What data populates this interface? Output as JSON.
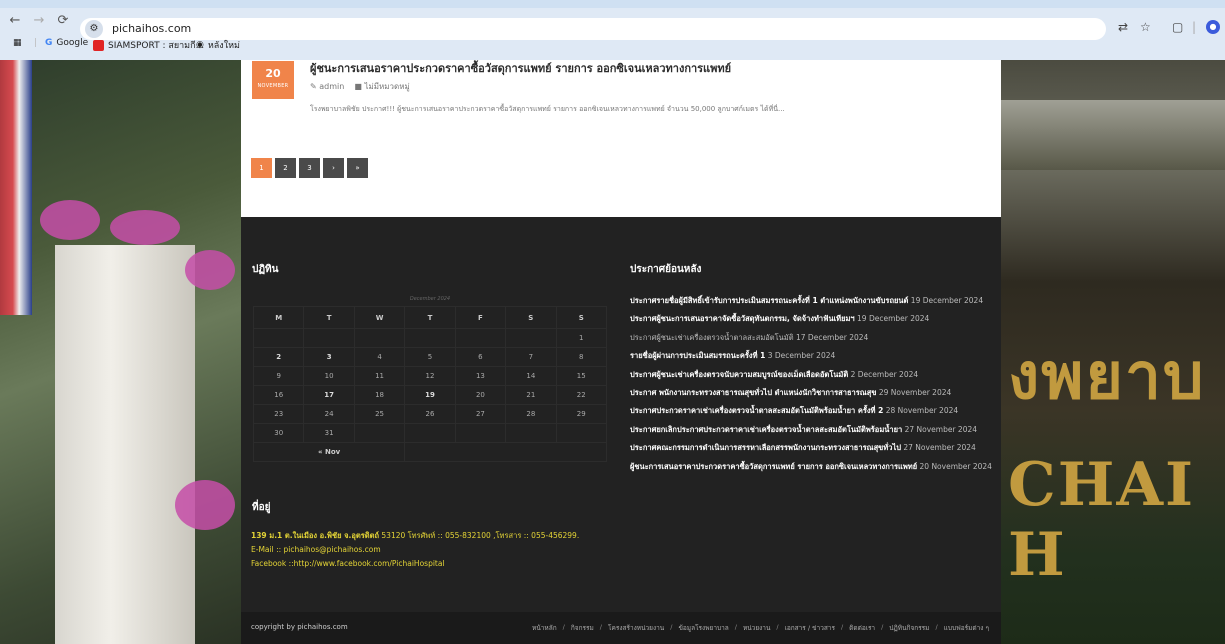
{
  "browser": {
    "url": "pichaihos.com",
    "bookmarks": [
      {
        "label": "Google",
        "icon": "google-icon"
      },
      {
        "label": "SIAMSPORT : สยามกี...",
        "icon": "siamsport-icon"
      },
      {
        "label": "หลังใหม่",
        "icon": "globe-icon"
      }
    ]
  },
  "post": {
    "day": "20",
    "month": "NOVEMBER",
    "title": "ผู้ชนะการเสนอราคาประกวดราคาซื้อวัสดุการแพทย์ รายการ ออกซิเจนเหลวทางการแพทย์",
    "author": "admin",
    "category": "ไม่มีหมวดหมู่",
    "excerpt": "โรงพยาบาลพิชัย ประกาศ!!! ผู้ชนะการเสนอราคาประกวดราคาซื้อวัสดุการแพทย์ รายการ ออกซิเจนเหลวทางการแพทย์ จำนวน 50,000 ลูกบาศก์เมตร ได้ที่นี่..."
  },
  "pagination": [
    "1",
    "2",
    "3",
    "›",
    "»"
  ],
  "calendar": {
    "title": "ปฏิทิน",
    "caption": "December 2024",
    "days": [
      "M",
      "T",
      "W",
      "T",
      "F",
      "S",
      "S"
    ],
    "rows": [
      [
        "",
        "",
        "",
        "",
        "",
        "",
        "1"
      ],
      [
        "2",
        "3",
        "4",
        "5",
        "6",
        "7",
        "8"
      ],
      [
        "9",
        "10",
        "11",
        "12",
        "13",
        "14",
        "15"
      ],
      [
        "16",
        "17",
        "18",
        "19",
        "20",
        "21",
        "22"
      ],
      [
        "23",
        "24",
        "25",
        "26",
        "27",
        "28",
        "29"
      ],
      [
        "30",
        "31",
        "",
        "",
        "",
        "",
        ""
      ]
    ],
    "prev": "« Nov"
  },
  "archive": {
    "title": "ประกาศย้อนหลัง",
    "items": [
      {
        "title": "ประกาศรายชื่อผู้มีสิทธิ์เข้ารับการประเมินสมรรถนะครั้งที่ 1 ตำแหน่งพนักงานขับรถยนต์",
        "date": "19 December 2024"
      },
      {
        "title": "ประกาศผู้ชนะการเสนอราคาจัดซื้อวัสดุทันตกรรม, จัดจ้างทำฟันเทียมฯ",
        "date": "19 December 2024"
      },
      {
        "title": "ประกาศผู้ชนะเช่าเครื่องตรวจน้ำตาลสะสมอัตโนมัติ",
        "date": "17 December 2024"
      },
      {
        "title": "รายชื่อผู้ผ่านการประเมินสมรรถนะครั้งที่ 1",
        "date": "3 December 2024"
      },
      {
        "title": "ประกาศผู้ชนะเช่าเครื่องตรวจนับความสมบูรณ์ของเม็ดเลือดอัตโนมัติ",
        "date": "2 December 2024"
      },
      {
        "title": "ประกาศ พนักงานกระทรวงสาธารณสุขทั่วไป ตำแหน่งนักวิชาการสาธารณสุข",
        "date": "29 November 2024"
      },
      {
        "title": "ประกาศประกวดราคาเช่าเครื่องตรวจน้ำตาลสะสมอัตโนมัติพร้อมน้ำยา ครั้งที่ 2",
        "date": "28 November 2024"
      },
      {
        "title": "ประกาศยกเลิกประกาศประกวดราคาเช่าเครื่องตรวจน้ำตาลสะสมอัตโนมัติพร้อมน้ำยา",
        "date": "27 November 2024"
      },
      {
        "title": "ประกาศคณะกรรมการดำเนินการสรรหาเลือกสรรพนักงานกระทรวงสาธารณสุขทั่วไป",
        "date": "27 November 2024"
      },
      {
        "title": "ผู้ชนะการเสนอราคาประกวดราคาซื้อวัสดุการแพทย์ รายการ ออกซิเจนเหลวทางการแพทย์",
        "date": "20 November 2024"
      }
    ]
  },
  "address": {
    "title": "ที่อยู่",
    "line1_bold": "139 ม.1 ต.ในเมือง อ.พิชัย จ.อุตรดิตถ์",
    "line1_rest": " 53120 โทรศัพท์ :: 055-832100 ,โทรสาร :: 055-456299.",
    "email": "E-Mail :: pichaihos@pichaihos.com",
    "facebook": "Facebook ::http://www.facebook.com/PichaiHospital"
  },
  "footer": {
    "copyright": "copyright by pichaihos.com",
    "menu": [
      "หน้าหลัก",
      "กิจกรรม",
      "โครงสร้างหน่วยงาน",
      "ข้อมูลโรงพยาบาล",
      "หน่วยงาน",
      "เอกสาร / ข่าวสาร",
      "ติดต่อเรา",
      "ปฏิทินกิจกรรม",
      "แบบฟอร์มต่าง ๆ"
    ]
  },
  "background_sign": {
    "line1": "งพยาบ",
    "line2": "CHAI H"
  },
  "colors": {
    "accent": "#f0844a",
    "footer_bg": "#222222",
    "address_text": "#e4d436"
  }
}
